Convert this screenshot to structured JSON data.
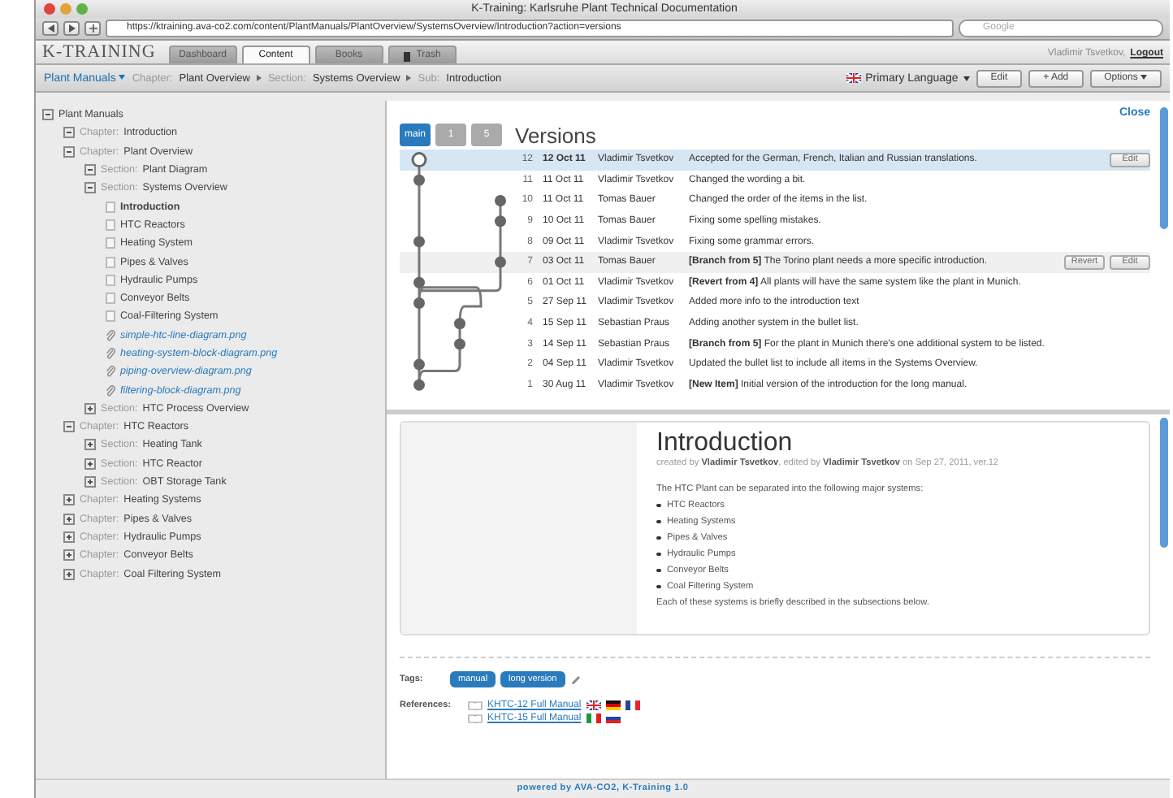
{
  "window": {
    "title": "K-Training: Karlsruhe Plant Technical Documentation"
  },
  "browser": {
    "url": "https://ktraining.ava-co2.com/content/PlantManuals/PlantOverview/SystemsOverview/Introduction?action=versions",
    "search_placeholder": "Google"
  },
  "app": {
    "logo": "K-TRAINING",
    "user": "Vladimir Tsvetkov,",
    "logout": "Logout",
    "tabs": [
      {
        "label": "Dashboard",
        "selected": false
      },
      {
        "label": "Content",
        "selected": true
      },
      {
        "label": "Books",
        "selected": false
      },
      {
        "label": "Trash",
        "selected": false
      }
    ]
  },
  "breadcrumb": {
    "root": "Plant Manuals",
    "items": [
      {
        "prefix": "Chapter:",
        "label": "Plant Overview"
      },
      {
        "prefix": "Section:",
        "label": "Systems Overview"
      },
      {
        "prefix": "Sub:",
        "label": "Introduction"
      }
    ],
    "language": "Primary Language",
    "buttons": [
      "Edit",
      "+ Add",
      "Options"
    ]
  },
  "tree": [
    {
      "kind": "root",
      "label": "Plant Manuals",
      "expanded": true,
      "selected": false,
      "children": [
        {
          "kind": "chapter",
          "prefix": "Chapter:",
          "label": "Introduction",
          "expanded": true,
          "selected": false
        },
        {
          "kind": "chapter",
          "prefix": "Chapter:",
          "label": "Plant Overview",
          "expanded": true,
          "selected": false,
          "children": [
            {
              "kind": "section",
              "prefix": "Section:",
              "label": "Plant Diagram",
              "expanded": true,
              "selected": false
            },
            {
              "kind": "section",
              "prefix": "Section:",
              "label": "Systems Overview",
              "expanded": true,
              "selected": false,
              "children": [
                {
                  "kind": "page",
                  "label": "Introduction",
                  "selected": true
                },
                {
                  "kind": "page",
                  "label": "HTC Reactors",
                  "selected": false
                },
                {
                  "kind": "page",
                  "label": "Heating System",
                  "selected": false
                },
                {
                  "kind": "page",
                  "label": "Pipes & Valves",
                  "selected": false
                },
                {
                  "kind": "page",
                  "label": "Hydraulic Pumps",
                  "selected": false
                },
                {
                  "kind": "page",
                  "label": "Conveyor Belts",
                  "selected": false
                },
                {
                  "kind": "page",
                  "label": "Coal-Filtering System",
                  "selected": false
                },
                {
                  "kind": "file",
                  "label": "simple-htc-line-diagram.png",
                  "selected": false
                },
                {
                  "kind": "file",
                  "label": "heating-system-block-diagram.png",
                  "selected": false
                },
                {
                  "kind": "file",
                  "label": "piping-overview-diagram.png",
                  "selected": false
                },
                {
                  "kind": "file",
                  "label": "filtering-block-diagram.png",
                  "selected": false
                }
              ]
            },
            {
              "kind": "section",
              "prefix": "Section:",
              "label": "HTC Process Overview",
              "expanded": false,
              "selected": false
            }
          ]
        },
        {
          "kind": "chapter",
          "prefix": "Chapter:",
          "label": "HTC Reactors",
          "expanded": true,
          "selected": false,
          "children": [
            {
              "kind": "section",
              "prefix": "Section:",
              "label": "Heating Tank",
              "expanded": false,
              "selected": false
            },
            {
              "kind": "section",
              "prefix": "Section:",
              "label": "HTC Reactor",
              "expanded": false,
              "selected": false
            },
            {
              "kind": "section",
              "prefix": "Section:",
              "label": "OBT Storage Tank",
              "expanded": false,
              "selected": false
            }
          ]
        },
        {
          "kind": "chapter",
          "prefix": "Chapter:",
          "label": "Heating Systems",
          "expanded": false,
          "selected": false
        },
        {
          "kind": "chapter",
          "prefix": "Chapter:",
          "label": "Pipes & Valves",
          "expanded": false,
          "selected": false
        },
        {
          "kind": "chapter",
          "prefix": "Chapter:",
          "label": "Hydraulic Pumps",
          "expanded": false,
          "selected": false
        },
        {
          "kind": "chapter",
          "prefix": "Chapter:",
          "label": "Conveyor Belts",
          "expanded": false,
          "selected": false
        },
        {
          "kind": "chapter",
          "prefix": "Chapter:",
          "label": "Coal Filtering System",
          "expanded": false,
          "selected": false
        }
      ]
    }
  ],
  "versions": {
    "title": "Versions",
    "close": "Close",
    "branches": [
      {
        "label": "main",
        "selected": true
      },
      {
        "label": "1",
        "selected": false
      },
      {
        "label": "5",
        "selected": false
      }
    ],
    "rows": [
      {
        "number": "12",
        "date": "12 Oct 11",
        "author": "Vladimir Tsvetkov",
        "text": "Accepted for the German, French, Italian and Russian translations.",
        "selected": true,
        "buttons": [
          "Edit"
        ]
      },
      {
        "number": "11",
        "date": "11 Oct 11",
        "author": "Vladimir Tsvetkov",
        "text": "Changed the wording a bit.",
        "selected": false,
        "buttons": []
      },
      {
        "number": "10",
        "date": "11 Oct 11",
        "author": "Tomas Bauer",
        "text": "Changed the order of the items in the list.",
        "selected": false,
        "buttons": []
      },
      {
        "number": "9",
        "date": "10 Oct 11",
        "author": "Tomas Bauer",
        "text": "Fixing some spelling mistakes.",
        "selected": false,
        "buttons": []
      },
      {
        "number": "8",
        "date": "09 Oct 11",
        "author": "Vladimir Tsvetkov",
        "text": "Fixing some grammar errors.",
        "selected": false,
        "buttons": []
      },
      {
        "number": "7",
        "date": "03 Oct 11",
        "author": "Tomas Bauer",
        "text": "**[Branch from 5]** The Torino plant needs a more specific introduction.",
        "selected": false,
        "hovered": true,
        "buttons": [
          "Revert",
          "Edit"
        ]
      },
      {
        "number": "6",
        "date": "01 Oct 11",
        "author": "Vladimir Tsvetkov",
        "text": "**[Revert from 4]** All plants will have the same system like the plant in Munich.",
        "selected": false,
        "buttons": []
      },
      {
        "number": "5",
        "date": "27 Sep 11",
        "author": "Vladimir Tsvetkov",
        "text": "Added more info to the introduction text",
        "selected": false,
        "buttons": []
      },
      {
        "number": "4",
        "date": "15 Sep 11",
        "author": "Sebastian Praus",
        "text": "Adding another system in the bullet list.",
        "selected": false,
        "buttons": []
      },
      {
        "number": "3",
        "date": "14 Sep 11",
        "author": "Sebastian Praus",
        "text": "**[Branch from 5]** For the plant in Munich there's one additional system to be listed.",
        "selected": false,
        "buttons": []
      },
      {
        "number": "2",
        "date": "04 Sep 11",
        "author": "Vladimir Tsvetkov",
        "text": "Updated the bullet list to include all items in the Systems Overview.",
        "selected": false,
        "buttons": []
      },
      {
        "number": "1",
        "date": "30 Aug 11",
        "author": "Vladimir Tsvetkov",
        "text": "**[New Item]** Initial version of the introduction for the long manual.",
        "selected": false,
        "buttons": []
      }
    ]
  },
  "document": {
    "title": "Introduction",
    "meta": "created by **Vladimir Tsvetkov**, edited by **Vladimir Tsvetkov** on Sep 27, 2011, ver.12",
    "intro": "The HTC Plant can be separated into the following major systems:",
    "bullets": [
      "HTC Reactors",
      "Heating Systems",
      "Pipes & Valves",
      "Hydraulic Pumps",
      "Conveyor Belts",
      "Coal Filtering System"
    ],
    "outro": "Each of these systems is briefly described in the subsections below."
  },
  "tags": {
    "label": "Tags:",
    "items": [
      "manual",
      "long version"
    ]
  },
  "references": {
    "label": "References:",
    "items": [
      {
        "title": "KHTC-12 Full Manual",
        "flags": [
          {
            "kind": "uk"
          },
          {
            "kind": "de"
          },
          {
            "kind": "fr"
          }
        ]
      },
      {
        "title": "KHTC-15 Full Manual",
        "flags": [
          {
            "kind": "it"
          },
          {
            "kind": "ru"
          }
        ]
      }
    ]
  },
  "footer": "powered by AVA-CO2, K-Training 1.0"
}
